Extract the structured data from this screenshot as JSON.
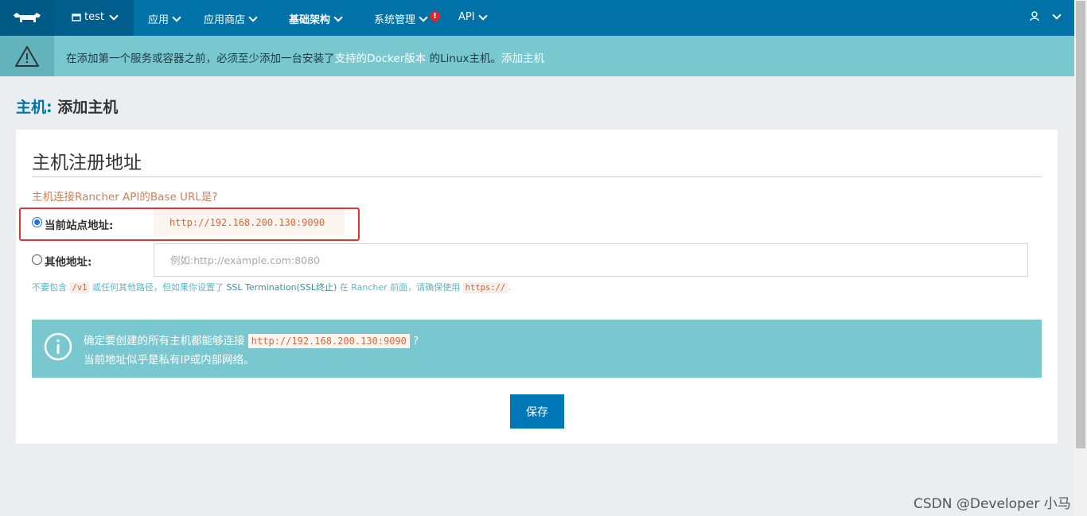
{
  "nav": {
    "env_name": "test",
    "items": [
      {
        "label": "应用"
      },
      {
        "label": "应用商店"
      },
      {
        "label": "基础架构"
      },
      {
        "label": "系统管理"
      },
      {
        "label": "API"
      }
    ],
    "alert_badge": "!"
  },
  "banner": {
    "text_before": "在添加第一个服务或容器之前，必须至少添加一台安装了",
    "link_docker": "支持的Docker版本",
    "text_after": " 的Linux主机。",
    "link_add": "添加主机"
  },
  "page": {
    "crumb": "主机",
    "colon": ": ",
    "title": "添加主机"
  },
  "card": {
    "title": "主机注册地址",
    "question": "主机连接Rancher API的Base URL是?",
    "option_current_label": "当前站点地址:",
    "current_url": "http://192.168.200.130:9090",
    "option_other_label": "其他地址:",
    "other_placeholder": "例如:http://example.com:8080",
    "hint": {
      "p1": "不要包含 ",
      "code1": "/v1",
      "p2": " 或任何其他路径，但如果你设置了 ",
      "p3": "SSL Termination(SSL终止)",
      "p4": " 在 Rancher 前面，请确保使用 ",
      "code2": "https://",
      "p5": "."
    },
    "info": {
      "line1_before": "确定要创建的所有主机都能够连接 ",
      "line1_code": "http://192.168.200.130:9090",
      "line1_after": " ?",
      "line2": "当前地址似乎是私有IP或内部网络。"
    },
    "save_label": "保存"
  },
  "watermark": "CSDN @Developer 小马"
}
